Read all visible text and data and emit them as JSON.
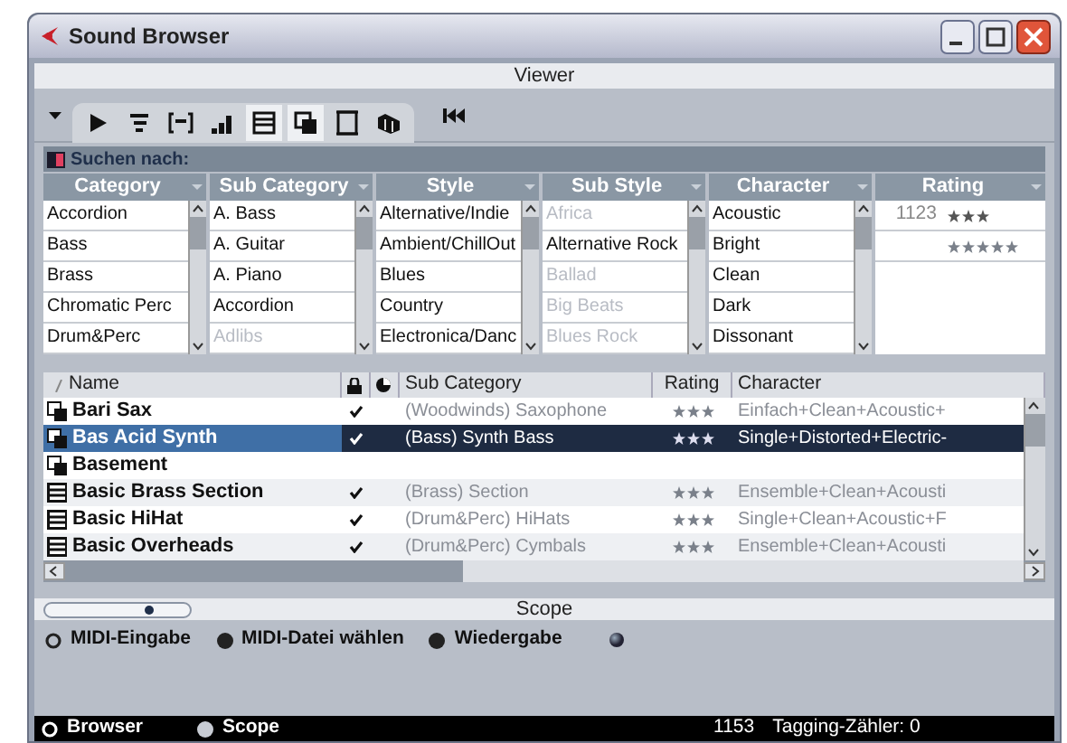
{
  "window": {
    "title": "Sound Browser"
  },
  "viewer": {
    "title": "Viewer"
  },
  "search": {
    "label": "Suchen nach:",
    "filters": [
      {
        "header": "Category",
        "items": [
          {
            "label": "Accordion",
            "available": true
          },
          {
            "label": "Bass",
            "available": true
          },
          {
            "label": "Brass",
            "available": true
          },
          {
            "label": "Chromatic Perc",
            "available": true
          },
          {
            "label": "Drum&Perc",
            "available": true
          }
        ]
      },
      {
        "header": "Sub Category",
        "items": [
          {
            "label": "A. Bass",
            "available": true
          },
          {
            "label": "A. Guitar",
            "available": true
          },
          {
            "label": "A. Piano",
            "available": true
          },
          {
            "label": "Accordion",
            "available": true
          },
          {
            "label": "Adlibs",
            "available": false
          }
        ]
      },
      {
        "header": "Style",
        "items": [
          {
            "label": "Alternative/Indie",
            "available": true
          },
          {
            "label": "Ambient/ChillOut",
            "available": true
          },
          {
            "label": "Blues",
            "available": true
          },
          {
            "label": "Country",
            "available": true
          },
          {
            "label": "Electronica/Danc",
            "available": true
          }
        ]
      },
      {
        "header": "Sub Style",
        "items": [
          {
            "label": "Africa",
            "available": false
          },
          {
            "label": "Alternative Rock",
            "available": true
          },
          {
            "label": "Ballad",
            "available": false
          },
          {
            "label": "Big Beats",
            "available": false
          },
          {
            "label": "Blues Rock",
            "available": false
          }
        ]
      },
      {
        "header": "Character",
        "items": [
          {
            "label": "Acoustic",
            "available": true
          },
          {
            "label": "Bright",
            "available": true
          },
          {
            "label": "Clean",
            "available": true
          },
          {
            "label": "Dark",
            "available": true
          },
          {
            "label": "Dissonant",
            "available": true
          }
        ]
      }
    ],
    "rating": {
      "header": "Rating",
      "items": [
        {
          "count": "1123",
          "stars": 3,
          "available": true
        },
        {
          "stars": 5,
          "available": false
        }
      ]
    }
  },
  "results": {
    "columns": {
      "name": "Name",
      "sub_category": "Sub Category",
      "rating": "Rating",
      "character": "Character"
    },
    "rows": [
      {
        "kind": "preset",
        "name": "Bari Sax",
        "locked": true,
        "sub_category": "(Woodwinds) Saxophone",
        "stars": 3,
        "character": "Einfach+Clean+Acoustic+",
        "selected": false
      },
      {
        "kind": "preset",
        "name": "Bas Acid Synth",
        "locked": true,
        "sub_category": "(Bass) Synth Bass",
        "stars": 3,
        "character": "Single+Distorted+Electric-",
        "selected": true
      },
      {
        "kind": "preset",
        "name": "Basement",
        "locked": false,
        "selected": false
      },
      {
        "kind": "list",
        "name": "Basic Brass Section",
        "locked": true,
        "sub_category": "(Brass) Section",
        "stars": 3,
        "character": "Ensemble+Clean+Acousti",
        "selected": false
      },
      {
        "kind": "list",
        "name": "Basic HiHat",
        "locked": true,
        "sub_category": "(Drum&Perc) HiHats",
        "stars": 3,
        "character": "Single+Clean+Acoustic+F",
        "selected": false
      },
      {
        "kind": "list",
        "name": "Basic Overheads",
        "locked": true,
        "sub_category": "(Drum&Perc) Cymbals",
        "stars": 3,
        "character": "Ensemble+Clean+Acousti",
        "selected": false
      }
    ]
  },
  "scope": {
    "title": "Scope",
    "slider": {
      "level": 0.72
    },
    "options": [
      {
        "label": "MIDI-Eingabe",
        "selected": false
      },
      {
        "label": "MIDI-Datei wählen",
        "selected": true
      },
      {
        "label": "Wiedergabe",
        "selected": true
      }
    ]
  },
  "status_bar": {
    "modes": [
      {
        "label": "Browser",
        "selected": false
      },
      {
        "label": "Scope",
        "selected": true
      }
    ],
    "count": "1153",
    "tagging": "Tagging-Zähler: 0"
  }
}
